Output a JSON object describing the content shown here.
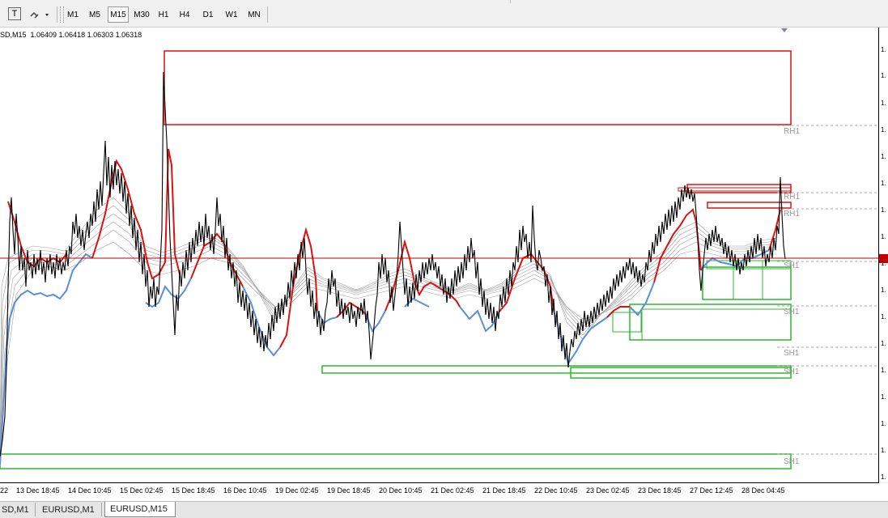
{
  "toolbar": {
    "text_tool_label": "T",
    "timeframes": [
      {
        "label": "M1",
        "active": false
      },
      {
        "label": "M5",
        "active": false
      },
      {
        "label": "M15",
        "active": true
      },
      {
        "label": "M30",
        "active": false
      },
      {
        "label": "H1",
        "active": false
      },
      {
        "label": "H4",
        "active": false
      },
      {
        "label": "D1",
        "active": false
      },
      {
        "label": "W1",
        "active": false
      },
      {
        "label": "MN",
        "active": false
      }
    ]
  },
  "chart": {
    "title": "SD,M15  1.06409 1.06418 1.06303 1.06318",
    "price_label": "1.",
    "level_labels": [
      "RH1",
      "RH1",
      "RH1",
      "SH1",
      "SH1",
      "SH1",
      "SH1",
      "SH1"
    ],
    "time_labels": [
      "22",
      "13 Dec 18:45",
      "14 Dec 10:45",
      "15 Dec 02:45",
      "15 Dec 18:45",
      "16 Dec 10:45",
      "19 Dec 02:45",
      "19 Dec 18:45",
      "20 Dec 10:45",
      "21 Dec 02:45",
      "21 Dec 18:45",
      "22 Dec 10:45",
      "23 Dec 02:45",
      "23 Dec 18:45",
      "27 Dec 12:45",
      "28 Dec 04:45"
    ],
    "colors": {
      "price_line": "#000000",
      "resistance": "#e01010",
      "support": "#2eb82e",
      "ma_fast_up": "#e01010",
      "ma_fast_down": "#5a8fd8",
      "ma_ribbon": "#9a9a9a",
      "bid_line": "#c00000"
    }
  },
  "tabs": [
    {
      "label": "SD,M1",
      "active": false
    },
    {
      "label": "EURUSD,M1",
      "active": false
    },
    {
      "label": "EURUSD,M15",
      "active": true
    }
  ]
}
